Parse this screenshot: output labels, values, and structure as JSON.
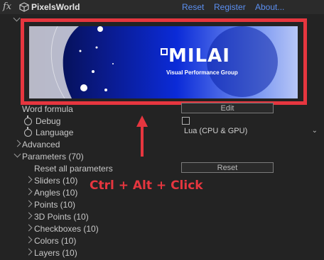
{
  "header": {
    "fx_label": "fx",
    "plugin_name": "PixelsWorld",
    "links": [
      "Reset",
      "Register",
      "About..."
    ]
  },
  "banner": {
    "brand": "MILAI",
    "tagline": "Visual Performance Group"
  },
  "rows": {
    "word_formula": {
      "label": "Word formula",
      "button": "Edit"
    },
    "debug": {
      "label": "Debug",
      "checked": false
    },
    "language": {
      "label": "Language",
      "value": "Lua (CPU & GPU)"
    },
    "advanced": {
      "label": "Advanced"
    },
    "parameters": {
      "label": "Parameters (70)"
    },
    "reset_all": {
      "label": "Reset all parameters",
      "button": "Reset"
    },
    "groups": [
      "Sliders (10)",
      "Angles (10)",
      "Points (10)",
      "3D Points (10)",
      "Checkboxes (10)",
      "Colors (10)",
      "Layers (10)"
    ]
  },
  "annotation": {
    "text": "Ctrl + Alt + Click",
    "color": "#e6363f"
  },
  "colors": {
    "link": "#5b8ff0",
    "panel_bg": "#232323",
    "highlight": "#e6363f"
  }
}
